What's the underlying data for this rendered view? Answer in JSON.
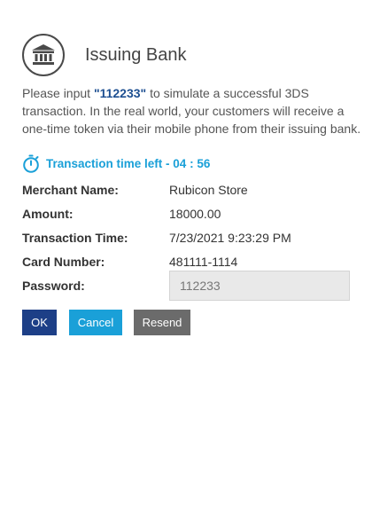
{
  "header": {
    "icon": "bank-building-icon",
    "title": "Issuing Bank"
  },
  "instructions": {
    "prefix": "Please input ",
    "otp": "\"112233\"",
    "suffix": " to simulate a successful 3DS transaction. In the real world, your customers will receive a one-time token via their mobile phone from their issuing bank."
  },
  "timer": {
    "icon": "stopwatch-icon",
    "label": "Transaction time left -",
    "minutes": "04",
    "separator": " : ",
    "seconds": "56"
  },
  "details": {
    "merchant_label": "Merchant Name:",
    "merchant_value": "Rubicon Store",
    "amount_label": "Amount:",
    "amount_value": "18000.00",
    "time_label": "Transaction Time:",
    "time_value": "7/23/2021 9:23:29 PM",
    "card_label": "Card Number:",
    "card_value": "481111-1114",
    "password_label": "Password:",
    "password_value": "112233"
  },
  "buttons": {
    "ok": "OK",
    "cancel": "Cancel",
    "resend": "Resend"
  },
  "colors": {
    "primary_button": "#1d3f87",
    "cancel_button": "#1aa0d8",
    "resend_button": "#6b6b6b",
    "timer_text": "#1aa0d8",
    "otp_text": "#1d4f91"
  }
}
